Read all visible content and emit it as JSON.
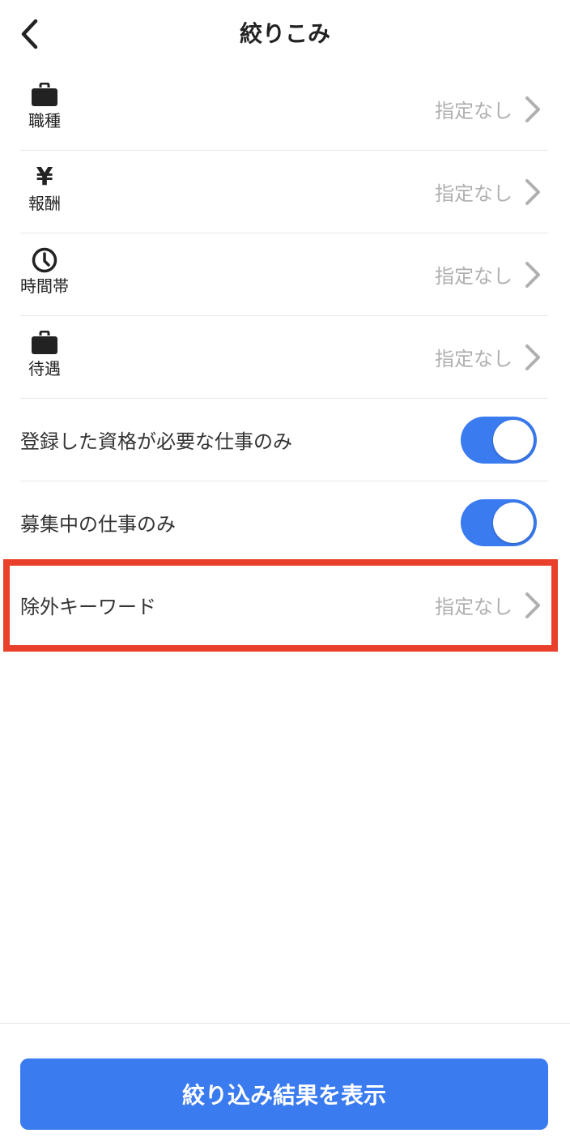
{
  "header": {
    "title": "絞りこみ",
    "back_icon": "chevron-left-icon"
  },
  "filters": [
    {
      "label": "職種",
      "icon": "briefcase-icon",
      "value": "指定なし"
    },
    {
      "label": "報酬",
      "icon": "yen-icon",
      "value": "指定なし",
      "icon_glyph": "¥"
    },
    {
      "label": "時間帯",
      "icon": "clock-icon",
      "value": "指定なし"
    },
    {
      "label": "待遇",
      "icon": "briefcase-icon",
      "value": "指定なし"
    }
  ],
  "toggles": [
    {
      "label": "登録した資格が必要な仕事のみ",
      "on": true
    },
    {
      "label": "募集中の仕事のみ",
      "on": true
    }
  ],
  "exclude_keyword": {
    "label": "除外キーワード",
    "value": "指定なし"
  },
  "footer": {
    "submit_label": "絞り込み結果を表示"
  },
  "colors": {
    "accent": "#3a7bf0",
    "highlight": "#e8402a",
    "muted_text": "#b0b0b0"
  }
}
